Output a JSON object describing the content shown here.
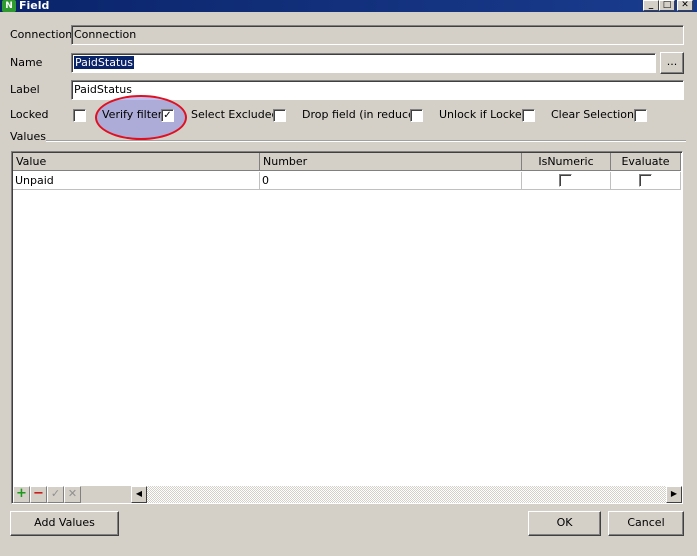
{
  "window": {
    "title": "Field",
    "app_icon_letter": "N"
  },
  "title_buttons": {
    "minimize": "_",
    "maximize": "□",
    "close": "✕"
  },
  "form": {
    "connection_label": "Connection",
    "connection_value": "Connection",
    "name_label": "Name",
    "name_value": "PaidStatus",
    "browse_label": "...",
    "label_label": "Label",
    "label_value": "PaidStatus"
  },
  "options": {
    "locked": {
      "label": "Locked",
      "checked": false
    },
    "verify_filter": {
      "label": "Verify filter",
      "checked": true
    },
    "select_excluded": {
      "label": "Select Excluded",
      "checked": false
    },
    "drop_field": {
      "label": "Drop field (in reduce)",
      "checked": false
    },
    "unlock_if_locked": {
      "label": "Unlock if Locked",
      "checked": false
    },
    "clear_selections": {
      "label": "Clear Selections",
      "checked": false
    }
  },
  "values_section_label": "Values",
  "values_grid": {
    "columns": [
      "Value",
      "Number",
      "IsNumeric",
      "Evaluate"
    ],
    "rows": [
      {
        "value": "Unpaid",
        "number": "0",
        "is_numeric": false,
        "evaluate": false
      }
    ]
  },
  "grid_toolbar": {
    "add": "+",
    "remove": "−",
    "confirm": "✓",
    "cancel": "✕"
  },
  "buttons": {
    "add_values": "Add Values",
    "ok": "OK",
    "cancel": "Cancel"
  },
  "colors": {
    "title_bar": "#0a246a",
    "highlight_ring": "#e01020",
    "highlight_fill": "#8c8ce6"
  },
  "check_glyph": "✓"
}
